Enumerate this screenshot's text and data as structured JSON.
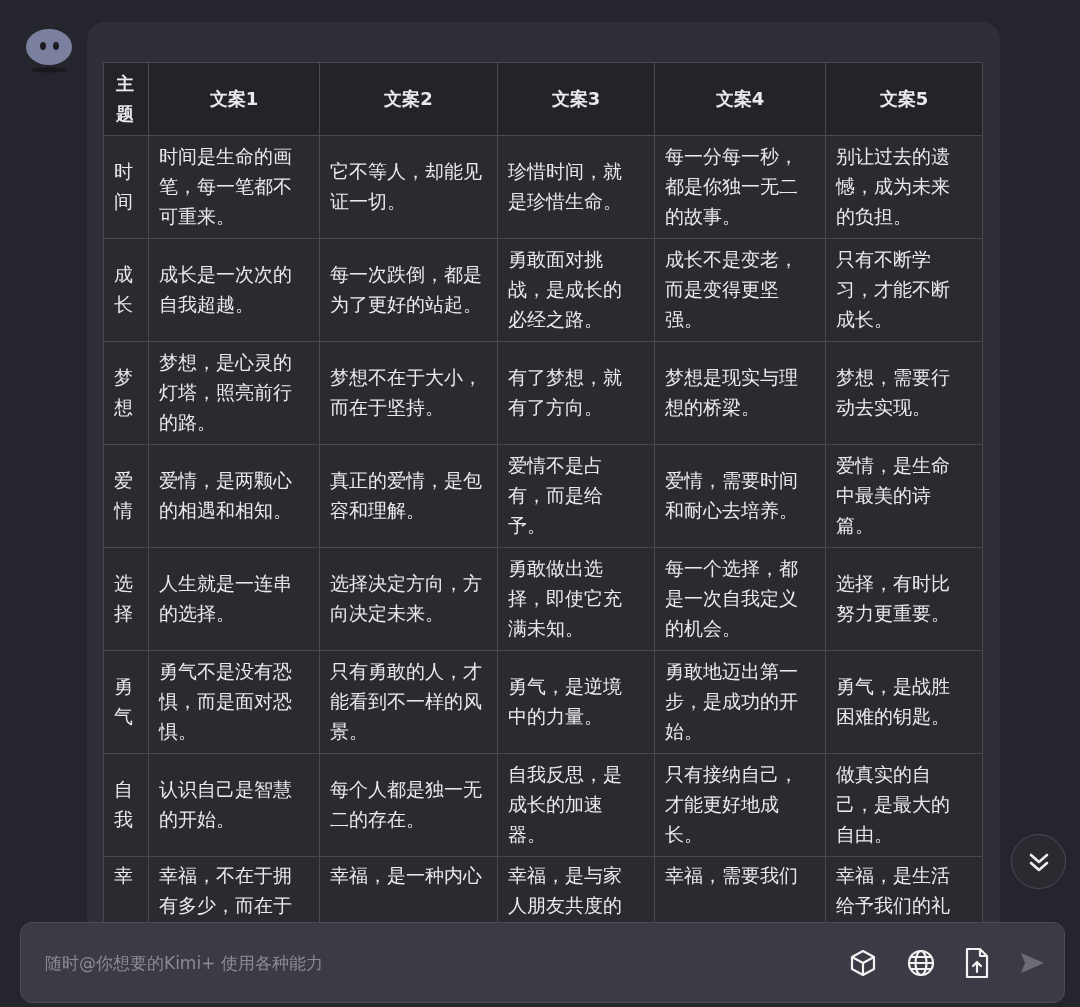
{
  "table": {
    "columns": [
      "主题",
      "文案1",
      "文案2",
      "文案3",
      "文案4",
      "文案5"
    ],
    "rows": [
      {
        "cells": [
          "时间",
          "时间是生命的画笔，每一笔都不可重来。",
          "它不等人，却能见证一切。",
          "珍惜时间，就是珍惜生命。",
          "每一分每一秒，都是你独一无二的故事。",
          "别让过去的遗憾，成为未来的负担。"
        ]
      },
      {
        "cells": [
          "成长",
          "成长是一次次的自我超越。",
          "每一次跌倒，都是为了更好的站起。",
          "勇敢面对挑战，是成长的必经之路。",
          "成长不是变老，而是变得更坚强。",
          "只有不断学习，才能不断成长。"
        ]
      },
      {
        "cells": [
          "梦想",
          "梦想，是心灵的灯塔，照亮前行的路。",
          "梦想不在于大小，而在于坚持。",
          "有了梦想，就有了方向。",
          "梦想是现实与理想的桥梁。",
          "梦想，需要行动去实现。"
        ]
      },
      {
        "cells": [
          "爱情",
          "爱情，是两颗心的相遇和相知。",
          "真正的爱情，是包容和理解。",
          "爱情不是占有，而是给予。",
          "爱情，需要时间和耐心去培养。",
          "爱情，是生命中最美的诗篇。"
        ]
      },
      {
        "cells": [
          "选择",
          "人生就是一连串的选择。",
          "选择决定方向，方向决定未来。",
          "勇敢做出选择，即使它充满未知。",
          "每一个选择，都是一次自我定义的机会。",
          "选择，有时比努力更重要。"
        ]
      },
      {
        "cells": [
          "勇气",
          "勇气不是没有恐惧，而是面对恐惧。",
          "只有勇敢的人，才能看到不一样的风景。",
          "勇气，是逆境中的力量。",
          "勇敢地迈出第一步，是成功的开始。",
          "勇气，是战胜困难的钥匙。"
        ]
      },
      {
        "cells": [
          "自我",
          "认识自己是智慧的开始。",
          "每个人都是独一无二的存在。",
          "自我反思，是成长的加速器。",
          "只有接纳自己，才能更好地成长。",
          "做真实的自己，是最大的自由。"
        ]
      },
      {
        "cells": [
          "幸",
          "幸福，不在于拥有多少，而在于",
          "幸福，是一种内心",
          "幸福，是与家人朋友共度的",
          "幸福，需要我们",
          "幸福，是生活给予我们的礼"
        ]
      }
    ]
  },
  "input": {
    "placeholder": "随时@你想要的Kimi+ 使用各种能力"
  }
}
